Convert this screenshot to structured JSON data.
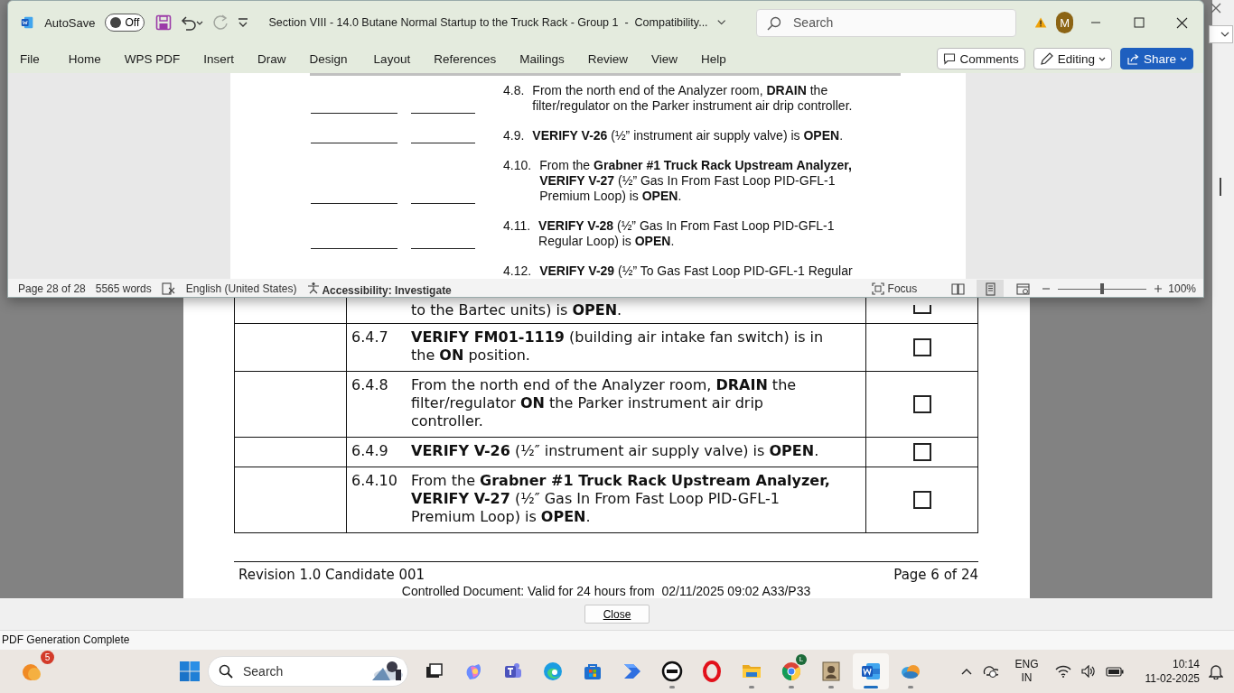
{
  "word_window": {
    "autosave": {
      "label": "AutoSave",
      "on": false,
      "state": "Off"
    },
    "redo": {
      "disabled": true
    },
    "title": "Section VIII - 14.0 Butane Normal Startup to the Truck Rack - Group 1  -  Compatibility...",
    "search": {
      "placeholder": "Search"
    },
    "avatar": "M",
    "ribbon_tabs": [
      "File",
      "Home",
      "WPS PDF",
      "Insert",
      "Draw",
      "Design",
      "Layout",
      "References",
      "Mailings",
      "Review",
      "View",
      "Help"
    ],
    "actions": [
      {
        "kind": "comments",
        "label": "Comments"
      },
      {
        "kind": "editing",
        "label": "Editing"
      },
      {
        "kind": "share",
        "label": "Share"
      }
    ],
    "document": {
      "steps": [
        {
          "number": "4.8.",
          "text": "From the north end of the Analyzer room, **DRAIN** the filter/regulator on the Parker instrument air drip controller.",
          "blank_lines": true
        },
        {
          "number": "4.9.",
          "text": "**VERIFY V-26** (½” instrument air supply valve) is **OPEN**.",
          "blank_lines": true
        },
        {
          "number": "4.10.",
          "text": "From the **Grabner #1 Truck Rack Upstream Analyzer, VERIFY V-27** (½” Gas In From Fast Loop PID-GFL-1 Premium Loop) is **OPEN**.",
          "blank_lines": true
        },
        {
          "number": "4.11.",
          "text": "**VERIFY V-28** (½” Gas In From Fast Loop PID-GFL-1 Regular Loop) is **OPEN**.",
          "blank_lines": true
        },
        {
          "number": "4.12.",
          "text": "**VERIFY V-29** (½” To Gas Fast Loop PID-GFL-1 Regular",
          "blank_lines": false
        }
      ]
    },
    "status_bar": {
      "page": "Page 28 of 28",
      "words": "5565 words",
      "language": "English (United States)",
      "accessibility": "Accessibility: Investigate",
      "focus": "Focus",
      "views": [
        {
          "kind": "read",
          "selected": false
        },
        {
          "kind": "print",
          "selected": true
        },
        {
          "kind": "web",
          "selected": false
        }
      ],
      "zoom": {
        "level": 0.5,
        "reading": "100%"
      }
    }
  },
  "pdf_viewer": {
    "rows": [
      {
        "number": "",
        "text": "to the Bartec units) is **OPEN**.",
        "checked": false
      },
      {
        "number": "6.4.7",
        "text": "**VERIFY FM01-1119** (building air intake fan switch) is in the **ON** position.",
        "checked": false
      },
      {
        "number": "6.4.8",
        "text": "From the north end of the Analyzer room, **DRAIN** the filter/regulator **ON** the Parker instrument air drip controller.",
        "checked": false
      },
      {
        "number": "6.4.9",
        "text": "**VERIFY V-26** (½″ instrument air supply valve) is **OPEN**.",
        "checked": false
      },
      {
        "number": "6.4.10",
        "text": "From the **Grabner #1 Truck Rack Upstream Analyzer, VERIFY V-27** (½″ Gas In From Fast Loop PID-GFL-1 Premium Loop) is **OPEN**.",
        "checked": false
      }
    ],
    "footer": {
      "revision": "Revision 1.0 Candidate 001",
      "page": "Page 6 of 24",
      "notice": "Controlled Document: Valid for 24 hours from  02/11/2025 09:02 A33/P33"
    },
    "close_button": "Close",
    "status": "PDF Generation Complete"
  },
  "taskbar": {
    "widget_badge": "5",
    "search": {
      "placeholder": "Search"
    },
    "apps": [
      {
        "kind": "desktops",
        "running": false,
        "active": false
      },
      {
        "kind": "copilot",
        "running": false,
        "active": false
      },
      {
        "kind": "teams",
        "running": false,
        "active": false
      },
      {
        "kind": "edge",
        "running": false,
        "active": false
      },
      {
        "kind": "store",
        "running": false,
        "active": false
      },
      {
        "kind": "automate",
        "running": false,
        "active": false
      },
      {
        "kind": "dell",
        "running": true,
        "active": false
      },
      {
        "kind": "opera",
        "running": false,
        "active": false
      },
      {
        "kind": "folder",
        "running": true,
        "active": false
      },
      {
        "kind": "chrome",
        "running": true,
        "active": false,
        "badge": "L"
      },
      {
        "kind": "portrait",
        "running": true,
        "active": false
      },
      {
        "kind": "word",
        "running": true,
        "active": true
      },
      {
        "kind": "cloud",
        "running": true,
        "active": false
      }
    ],
    "language": [
      "ENG",
      "IN"
    ],
    "time": "10:14",
    "date": "11-02-2025"
  }
}
